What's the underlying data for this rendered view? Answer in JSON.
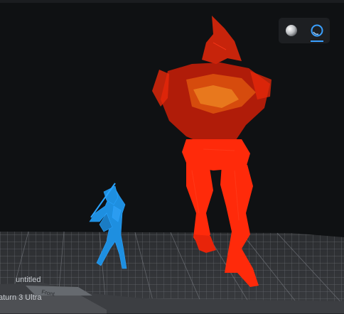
{
  "project": {
    "name": "untitled"
  },
  "printer": {
    "name": "aturn 3 Ultra"
  },
  "plate": {
    "front_label": "Front"
  },
  "view_toggle": {
    "solid_icon": "sphere-solid-icon",
    "xray_icon": "sphere-xray-icon",
    "active": "xray",
    "active_color": "#3aa0ff"
  },
  "models": [
    {
      "name": "blue-warrior",
      "color": "#1e8fe0"
    },
    {
      "name": "red-giant",
      "color": "#e8280a"
    }
  ]
}
